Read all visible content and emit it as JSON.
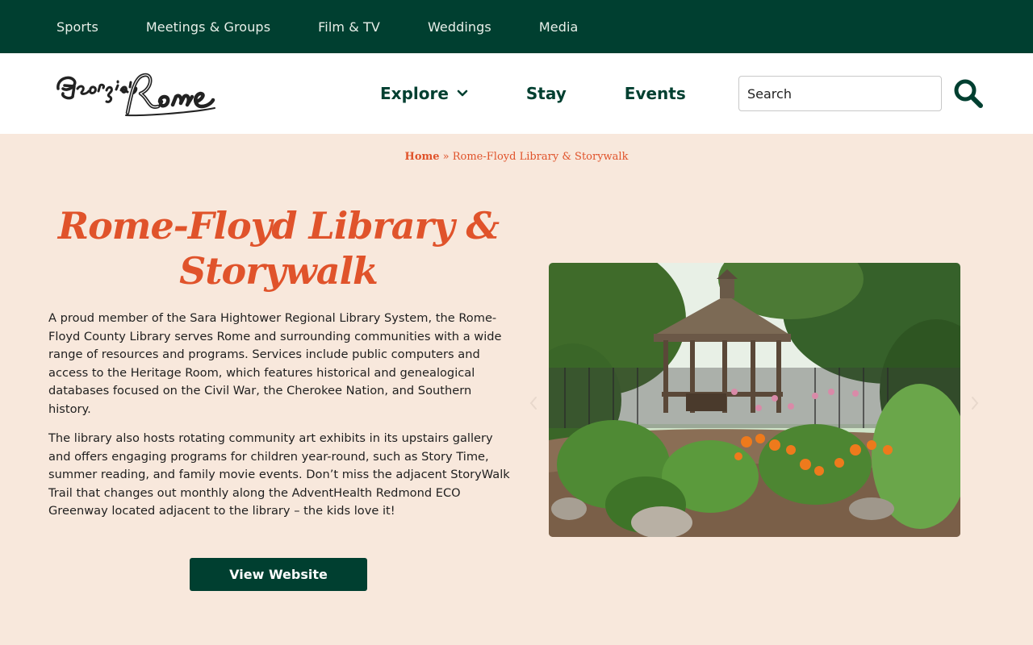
{
  "topnav": {
    "items": [
      "Sports",
      "Meetings & Groups",
      "Film & TV",
      "Weddings",
      "Media"
    ]
  },
  "header": {
    "logo_text": "Georgia's Rome",
    "nav": {
      "explore": "Explore",
      "stay": "Stay",
      "events": "Events"
    },
    "search": {
      "placeholder": "Search"
    }
  },
  "breadcrumb": {
    "home": "Home",
    "separator": " » ",
    "current": "Rome-Floyd Library & Storywalk"
  },
  "main": {
    "title": "Rome-Floyd Library & Storywalk",
    "paragraphs": [
      "A proud member of the Sara Hightower Regional Library System, the Rome-Floyd County Library serves Rome and surrounding communities with a wide range of resources and programs. Services include public computers and access to the Heritage Room, which features historical and genealogical databases focused on the Civil War, the Cherokee Nation, and Southern history.",
      "The library also hosts rotating community art exhibits in its upstairs gallery and offers engaging programs for children year-round, such as Story Time, summer reading, and family movie events. Don’t miss the adjacent StoryWalk Trail that changes out monthly along the AdventHealth Redmond ECO Greenway located adjacent to the library – the kids love it!"
    ],
    "button_label": "View Website"
  },
  "colors": {
    "brand_green": "#003f30",
    "accent_orange": "#e0532b",
    "page_bg": "#f8e8dc"
  },
  "icons": {
    "search": "search-icon",
    "chevron": "chevron-down-icon",
    "prev": "chevron-left-icon",
    "next": "chevron-right-icon"
  }
}
